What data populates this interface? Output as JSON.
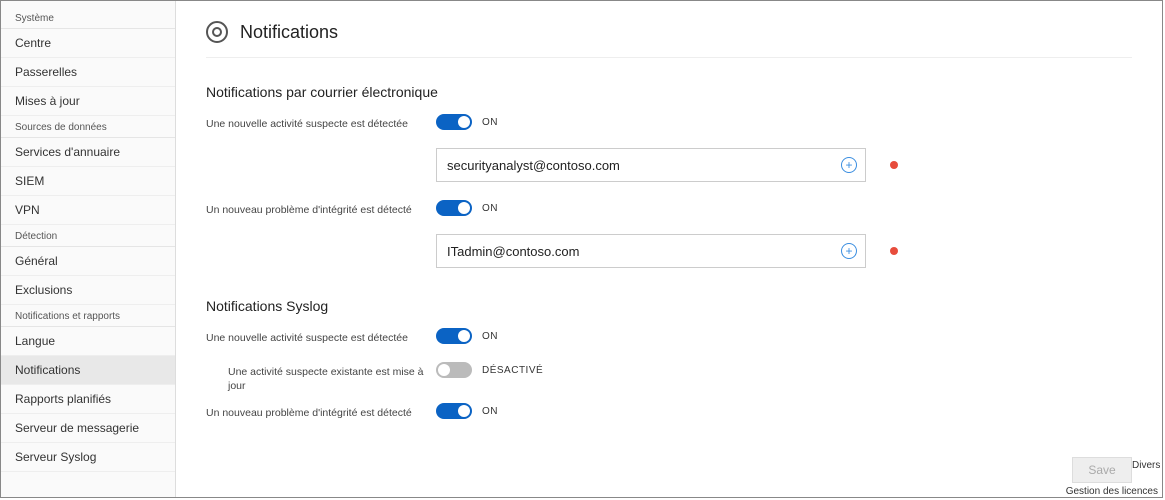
{
  "sidebar": {
    "sections": [
      {
        "title": "Système",
        "items": [
          "Centre",
          "Passerelles",
          "Mises à jour"
        ]
      },
      {
        "title": "Sources de données",
        "items": [
          "Services d'annuaire",
          "SIEM",
          "VPN"
        ]
      },
      {
        "title": "Détection",
        "items": [
          "Général",
          "Exclusions"
        ]
      },
      {
        "title": "Notifications et rapports",
        "items": [
          "Langue",
          "Notifications",
          "Rapports planifiés",
          "Serveur de messagerie",
          "Serveur Syslog"
        ]
      }
    ],
    "active": "Notifications"
  },
  "page": {
    "title": "Notifications"
  },
  "email_section": {
    "title": "Notifications par courrier électronique",
    "rows": [
      {
        "label": "Une nouvelle activité suspecte est détectée",
        "state": "on",
        "state_label": "ON",
        "email": "securityanalyst@contoso.com",
        "has_error": true
      },
      {
        "label": "Un nouveau problème d'intégrité est détecté",
        "state": "on",
        "state_label": "ON",
        "email": "ITadmin@contoso.com",
        "has_error": true
      }
    ]
  },
  "syslog_section": {
    "title": "Notifications Syslog",
    "rows": [
      {
        "label": "Une nouvelle activité suspecte est détectée",
        "state": "on",
        "state_label": "ON",
        "indent": false
      },
      {
        "label": "Une activité suspecte existante est mise à jour",
        "state": "off",
        "state_label": "DÉSACTIVÉ",
        "indent": true
      },
      {
        "label": "Un nouveau problème d'intégrité est détecté",
        "state": "on",
        "state_label": "ON",
        "indent": false
      }
    ]
  },
  "footer": {
    "save": "Save",
    "divers": "Divers",
    "license": "Gestion des licences"
  },
  "icons": {
    "plus": "+"
  }
}
